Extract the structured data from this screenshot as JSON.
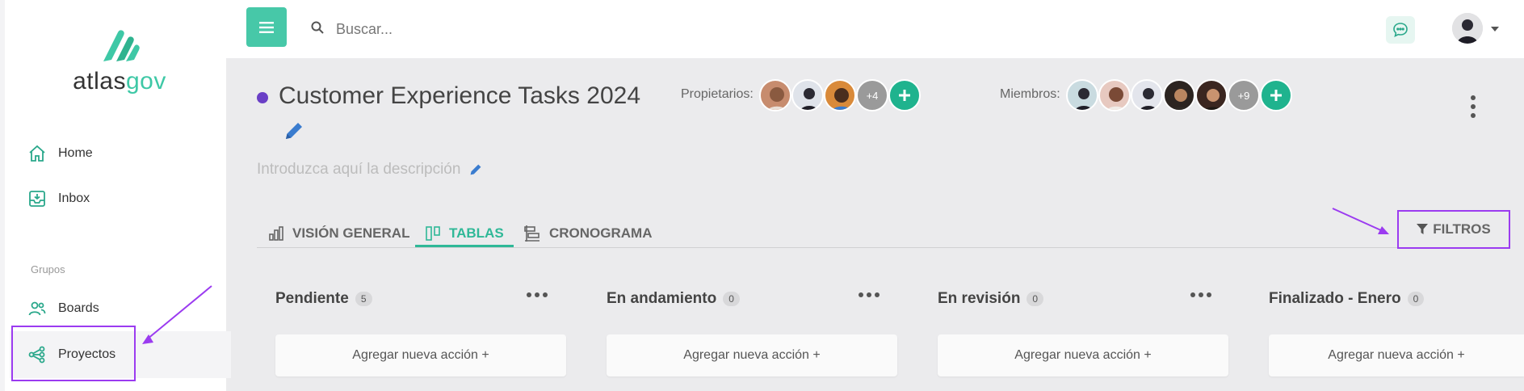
{
  "sidebar": {
    "logo_text_a": "atlas",
    "logo_text_b": "gov",
    "items": [
      {
        "label": "Home"
      },
      {
        "label": "Inbox"
      },
      {
        "label": "Boards"
      },
      {
        "label": "Proyectos"
      }
    ],
    "group_label": "Grupos"
  },
  "topbar": {
    "search_placeholder": "Buscar..."
  },
  "project": {
    "title": "Customer Experience Tasks 2024",
    "description_placeholder": "Introduzca aquí la descripción",
    "owners_label": "Propietarios:",
    "owners_more": "+4",
    "members_label": "Miembros:",
    "members_more": "+9"
  },
  "tabs": [
    {
      "label": "VISIÓN GENERAL"
    },
    {
      "label": "TABLAS",
      "active": true
    },
    {
      "label": "CRONOGRAMA"
    }
  ],
  "filters_label": "FILTROS",
  "columns": [
    {
      "title": "Pendiente",
      "count": "5",
      "add_label": "Agregar nueva acción +"
    },
    {
      "title": "En andamiento",
      "count": "0",
      "add_label": "Agregar nueva acción +"
    },
    {
      "title": "En revisión",
      "count": "0",
      "add_label": "Agregar nueva acción +"
    },
    {
      "title": "Finalizado - Enero",
      "count": "0",
      "add_label": "Agregar nueva acción +"
    }
  ],
  "colors": {
    "accent": "#47c8a8",
    "project_dot": "#6a3fc6",
    "annotation": "#9b3bf0"
  }
}
